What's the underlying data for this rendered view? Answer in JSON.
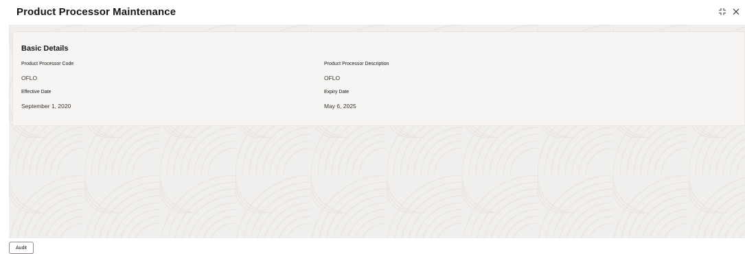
{
  "header": {
    "title": "Product Processor Maintenance",
    "actions": [
      {
        "icon": "minimize-icon"
      },
      {
        "icon": "close-icon"
      }
    ]
  },
  "basic_details": {
    "section_title": "Basic Details",
    "product_processor_code": {
      "label": "Product Processor Code",
      "value": "OFLO"
    },
    "product_processor_description": {
      "label": "Product Processor Description",
      "value": "OFLO"
    },
    "effective_date": {
      "label": "Effective Date",
      "value": "September 1, 2020"
    },
    "expiry_date": {
      "label": "Expiry Date",
      "value": "May 6, 2025"
    }
  },
  "footer": {
    "audit_label": "Audit"
  },
  "colors": {
    "background_pattern": "#f1efed",
    "card_background": "#f6f5f3",
    "text_primary": "#161513"
  }
}
